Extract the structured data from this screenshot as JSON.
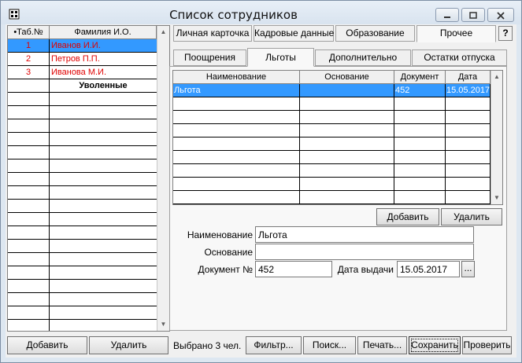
{
  "window": {
    "title": "Список сотрудников",
    "minimize_glyph": "▭",
    "maximize_glyph": "▢",
    "close_glyph": "✕"
  },
  "employees": {
    "headers": [
      "•Таб.№",
      "Фамилия И.О."
    ],
    "rows": [
      {
        "num": "1",
        "name": "Иванов И.И.",
        "selected": true
      },
      {
        "num": "2",
        "name": "Петров П.П.",
        "selected": false
      },
      {
        "num": "3",
        "name": "Иванова М.И.",
        "selected": false
      }
    ],
    "group_label": "Уволенные",
    "add_label": "Добавить",
    "delete_label": "Удалить"
  },
  "tabs_top": [
    "Личная карточка",
    "Кадровые данные",
    "Образование",
    "Прочее"
  ],
  "tabs_sub": [
    "Поощрения",
    "Льготы",
    "Дополнительно",
    "Остатки отпуска"
  ],
  "help_label": "?",
  "benefits_grid": {
    "headers": [
      "Наименование",
      "Основание",
      "Документ",
      "Дата"
    ],
    "rows": [
      {
        "name": "Льгота",
        "basis": "",
        "doc": "452",
        "date": "15.05.2017"
      }
    ],
    "add_label": "Добавить",
    "delete_label": "Удалить"
  },
  "form": {
    "name_label": "Наименование",
    "name_value": "Льгота",
    "basis_label": "Основание",
    "basis_value": "",
    "doc_label": "Документ №",
    "doc_value": "452",
    "date_label": "Дата выдачи",
    "date_value": "15.05.2017",
    "picker_label": "..."
  },
  "footer": {
    "selected_count": "Выбрано 3 чел.",
    "filter_label": "Фильтр...",
    "search_label": "Поиск...",
    "print_label": "Печать...",
    "save_label": "Сохранить",
    "check_label": "Проверить"
  },
  "colors": {
    "selection": "#3399ff",
    "employee_text": "#e00000"
  }
}
